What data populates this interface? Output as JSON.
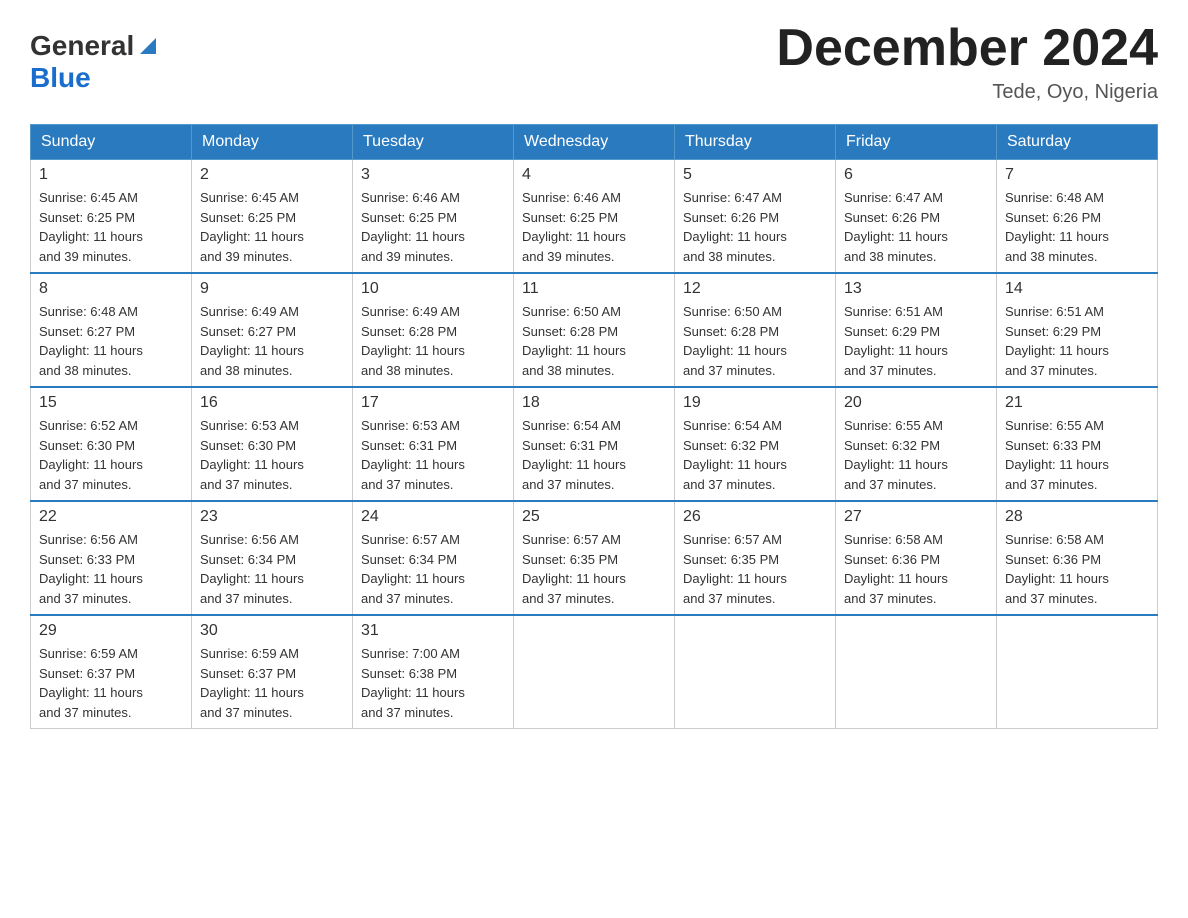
{
  "header": {
    "logo_general": "General",
    "logo_blue": "Blue",
    "month_title": "December 2024",
    "subtitle": "Tede, Oyo, Nigeria"
  },
  "days_of_week": [
    "Sunday",
    "Monday",
    "Tuesday",
    "Wednesday",
    "Thursday",
    "Friday",
    "Saturday"
  ],
  "weeks": [
    [
      {
        "date": "1",
        "sunrise": "6:45 AM",
        "sunset": "6:25 PM",
        "daylight": "11 hours and 39 minutes."
      },
      {
        "date": "2",
        "sunrise": "6:45 AM",
        "sunset": "6:25 PM",
        "daylight": "11 hours and 39 minutes."
      },
      {
        "date": "3",
        "sunrise": "6:46 AM",
        "sunset": "6:25 PM",
        "daylight": "11 hours and 39 minutes."
      },
      {
        "date": "4",
        "sunrise": "6:46 AM",
        "sunset": "6:25 PM",
        "daylight": "11 hours and 39 minutes."
      },
      {
        "date": "5",
        "sunrise": "6:47 AM",
        "sunset": "6:26 PM",
        "daylight": "11 hours and 38 minutes."
      },
      {
        "date": "6",
        "sunrise": "6:47 AM",
        "sunset": "6:26 PM",
        "daylight": "11 hours and 38 minutes."
      },
      {
        "date": "7",
        "sunrise": "6:48 AM",
        "sunset": "6:26 PM",
        "daylight": "11 hours and 38 minutes."
      }
    ],
    [
      {
        "date": "8",
        "sunrise": "6:48 AM",
        "sunset": "6:27 PM",
        "daylight": "11 hours and 38 minutes."
      },
      {
        "date": "9",
        "sunrise": "6:49 AM",
        "sunset": "6:27 PM",
        "daylight": "11 hours and 38 minutes."
      },
      {
        "date": "10",
        "sunrise": "6:49 AM",
        "sunset": "6:28 PM",
        "daylight": "11 hours and 38 minutes."
      },
      {
        "date": "11",
        "sunrise": "6:50 AM",
        "sunset": "6:28 PM",
        "daylight": "11 hours and 38 minutes."
      },
      {
        "date": "12",
        "sunrise": "6:50 AM",
        "sunset": "6:28 PM",
        "daylight": "11 hours and 37 minutes."
      },
      {
        "date": "13",
        "sunrise": "6:51 AM",
        "sunset": "6:29 PM",
        "daylight": "11 hours and 37 minutes."
      },
      {
        "date": "14",
        "sunrise": "6:51 AM",
        "sunset": "6:29 PM",
        "daylight": "11 hours and 37 minutes."
      }
    ],
    [
      {
        "date": "15",
        "sunrise": "6:52 AM",
        "sunset": "6:30 PM",
        "daylight": "11 hours and 37 minutes."
      },
      {
        "date": "16",
        "sunrise": "6:53 AM",
        "sunset": "6:30 PM",
        "daylight": "11 hours and 37 minutes."
      },
      {
        "date": "17",
        "sunrise": "6:53 AM",
        "sunset": "6:31 PM",
        "daylight": "11 hours and 37 minutes."
      },
      {
        "date": "18",
        "sunrise": "6:54 AM",
        "sunset": "6:31 PM",
        "daylight": "11 hours and 37 minutes."
      },
      {
        "date": "19",
        "sunrise": "6:54 AM",
        "sunset": "6:32 PM",
        "daylight": "11 hours and 37 minutes."
      },
      {
        "date": "20",
        "sunrise": "6:55 AM",
        "sunset": "6:32 PM",
        "daylight": "11 hours and 37 minutes."
      },
      {
        "date": "21",
        "sunrise": "6:55 AM",
        "sunset": "6:33 PM",
        "daylight": "11 hours and 37 minutes."
      }
    ],
    [
      {
        "date": "22",
        "sunrise": "6:56 AM",
        "sunset": "6:33 PM",
        "daylight": "11 hours and 37 minutes."
      },
      {
        "date": "23",
        "sunrise": "6:56 AM",
        "sunset": "6:34 PM",
        "daylight": "11 hours and 37 minutes."
      },
      {
        "date": "24",
        "sunrise": "6:57 AM",
        "sunset": "6:34 PM",
        "daylight": "11 hours and 37 minutes."
      },
      {
        "date": "25",
        "sunrise": "6:57 AM",
        "sunset": "6:35 PM",
        "daylight": "11 hours and 37 minutes."
      },
      {
        "date": "26",
        "sunrise": "6:57 AM",
        "sunset": "6:35 PM",
        "daylight": "11 hours and 37 minutes."
      },
      {
        "date": "27",
        "sunrise": "6:58 AM",
        "sunset": "6:36 PM",
        "daylight": "11 hours and 37 minutes."
      },
      {
        "date": "28",
        "sunrise": "6:58 AM",
        "sunset": "6:36 PM",
        "daylight": "11 hours and 37 minutes."
      }
    ],
    [
      {
        "date": "29",
        "sunrise": "6:59 AM",
        "sunset": "6:37 PM",
        "daylight": "11 hours and 37 minutes."
      },
      {
        "date": "30",
        "sunrise": "6:59 AM",
        "sunset": "6:37 PM",
        "daylight": "11 hours and 37 minutes."
      },
      {
        "date": "31",
        "sunrise": "7:00 AM",
        "sunset": "6:38 PM",
        "daylight": "11 hours and 37 minutes."
      },
      null,
      null,
      null,
      null
    ]
  ],
  "labels": {
    "sunrise": "Sunrise:",
    "sunset": "Sunset:",
    "daylight": "Daylight:"
  }
}
